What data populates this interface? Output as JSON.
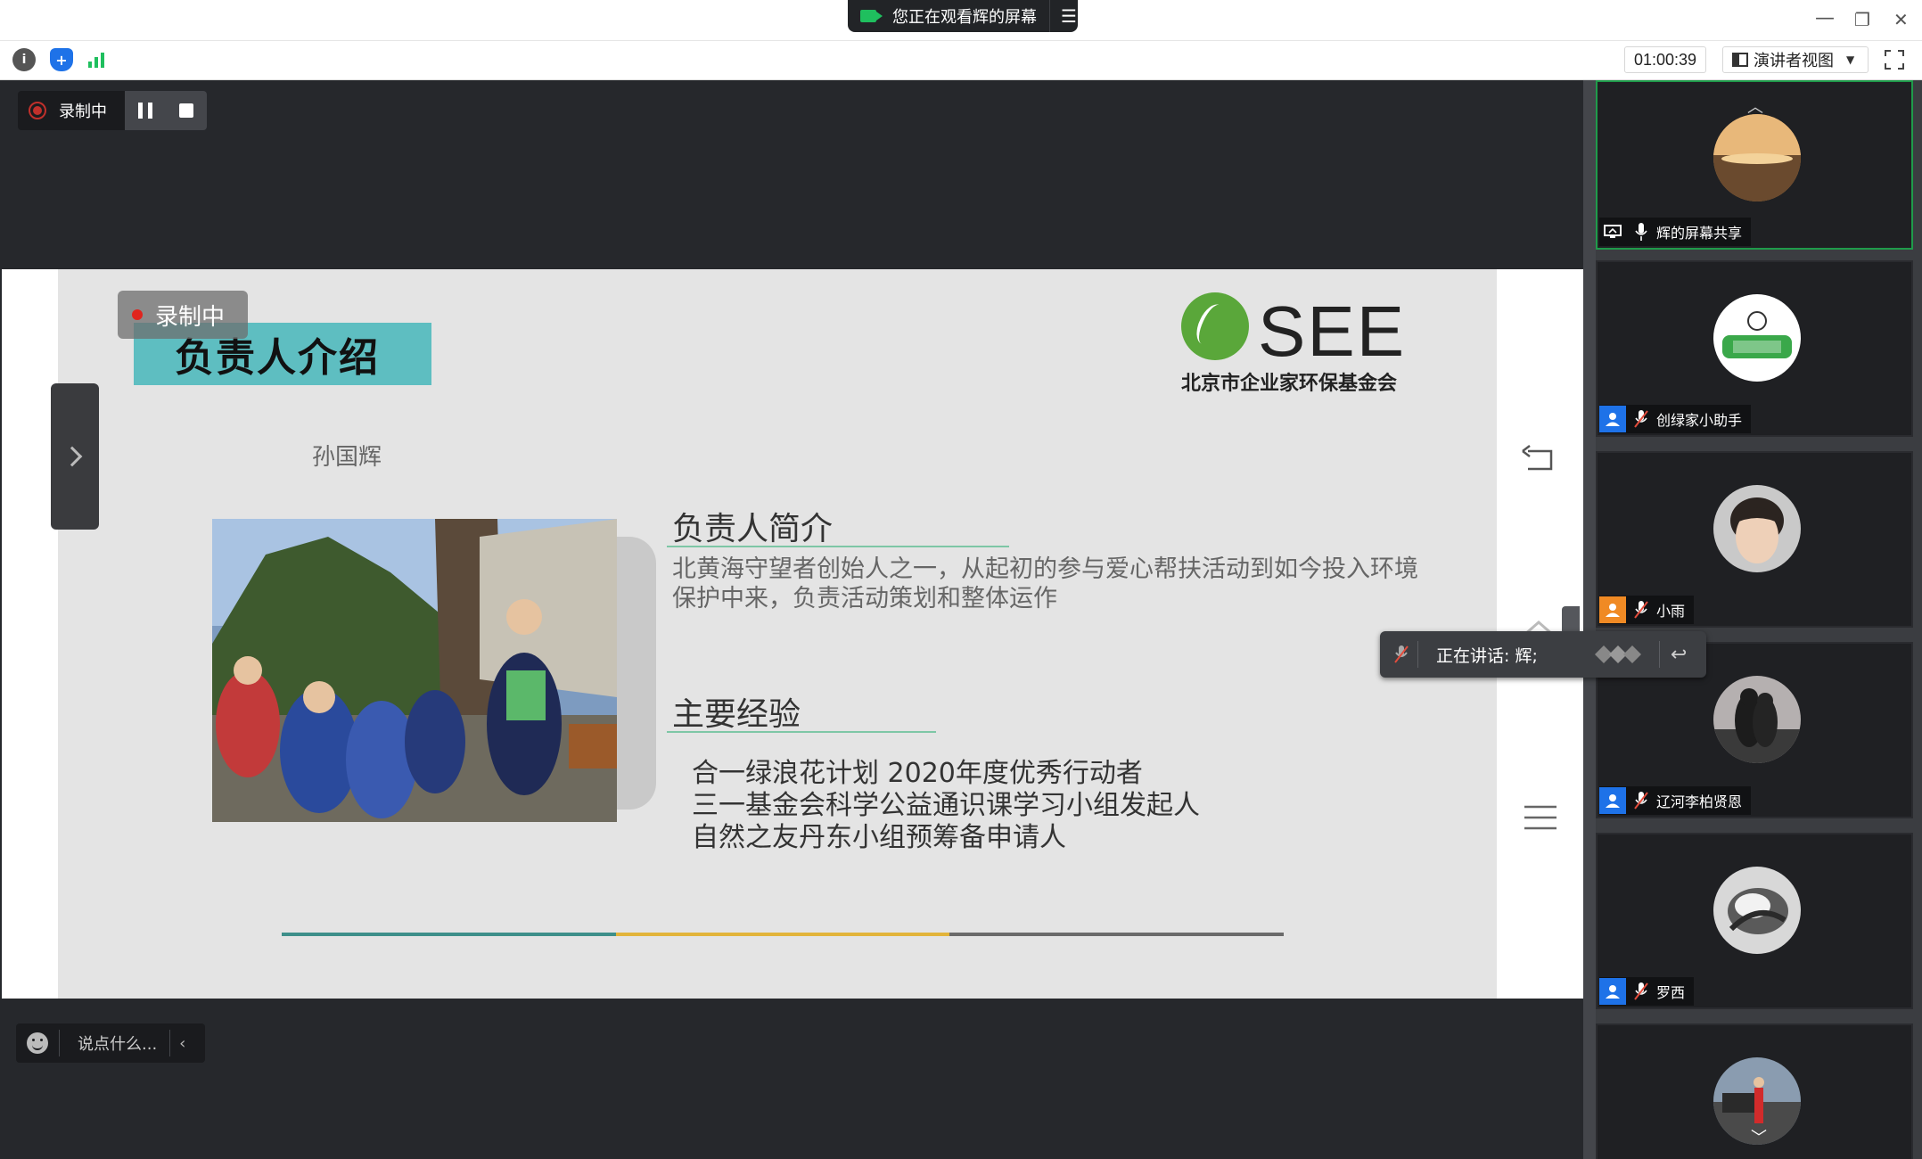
{
  "titlebar": {
    "share_status": "您正在观看辉的屏幕",
    "minimize_glyph": "—",
    "restore_glyph": "❐",
    "close_glyph": "✕"
  },
  "toolbar": {
    "timer": "01:00:39",
    "view_mode": "演讲者视图",
    "icons": [
      "info-icon",
      "shield-icon",
      "signal-icon",
      "fullscreen-icon"
    ]
  },
  "recording": {
    "label": "录制中"
  },
  "slide": {
    "rec_overlay": "录制中",
    "title": "负责人介绍",
    "logo_text": "SEE",
    "logo_subtitle": "北京市企业家环保基金会",
    "author": "孙国辉",
    "section1_heading": "负责人简介",
    "intro": "北黄海守望者创始人之一，从起初的参与爱心帮扶活动到如今投入环境保护中来，负责活动策划和整体运作",
    "section2_heading": "主要经验",
    "experience": [
      "合一绿浪花计划 2020年度优秀行动者",
      "三一基金会科学公益通识课学习小组发起人",
      "自然之友丹东小组预筹备申请人"
    ],
    "progress_colors": [
      "#3d8f8a",
      "#e2b43a",
      "#6a6a6a"
    ]
  },
  "speaking": {
    "label": "正在讲话: 辉;"
  },
  "chat": {
    "placeholder": "说点什么..."
  },
  "participants": [
    {
      "name": "辉的屏幕共享",
      "icon": "screen-share-icon",
      "mic": "mic-on",
      "active": true
    },
    {
      "name": "创绿家小助手",
      "icon": "user-icon",
      "mic": "mic-muted",
      "active": false
    },
    {
      "name": "小雨",
      "icon": "user-icon",
      "mic": "mic-muted",
      "active": false
    },
    {
      "name": "辽河李柏贤恩",
      "icon": "user-icon",
      "mic": "mic-muted",
      "active": false
    },
    {
      "name": "罗西",
      "icon": "user-icon",
      "mic": "mic-muted",
      "active": false
    }
  ],
  "colors": {
    "accent_green": "#1f9b4a",
    "slide_title_bg": "#5ebec1",
    "user_blue": "#1e72e8",
    "user_orange": "#f08a24"
  }
}
